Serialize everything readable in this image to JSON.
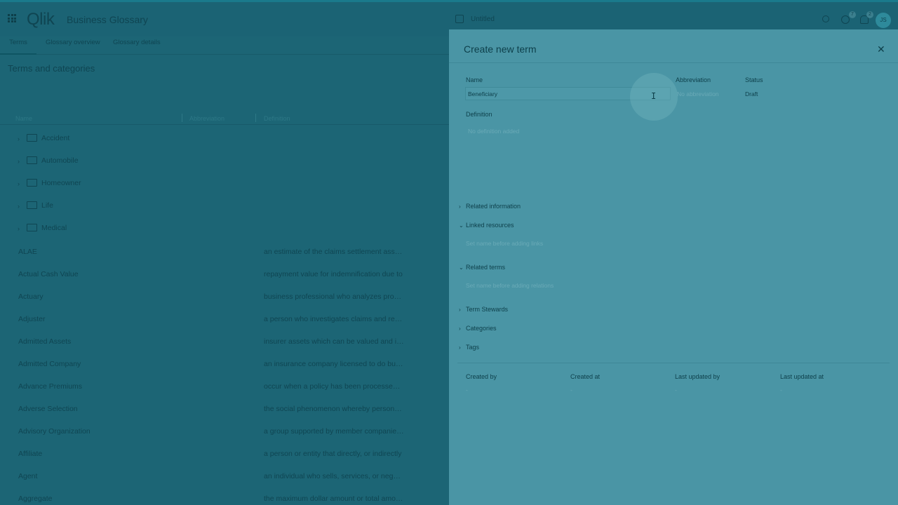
{
  "header": {
    "logo": "Qlik",
    "app_title": "Business Glossary",
    "sheet_name": "Untitled",
    "help_badge": "7",
    "notif_badge": "2",
    "avatar_initials": "JS"
  },
  "tabs": [
    {
      "label": "Terms"
    },
    {
      "label": "Glossary overview"
    },
    {
      "label": "Glossary details"
    }
  ],
  "main": {
    "section_title": "Terms and categories",
    "columns": [
      "Name",
      "Abbreviation",
      "Definition"
    ],
    "categories": [
      "Accident",
      "Automobile",
      "Homeowner",
      "Life",
      "Medical"
    ],
    "terms": [
      {
        "name": "ALAE",
        "definition": "an estimate of the claims settlement associated"
      },
      {
        "name": "Actual Cash Value",
        "definition": "repayment value for indemnification due to"
      },
      {
        "name": "Actuary",
        "definition": "business professional who analyzes probability"
      },
      {
        "name": "Adjuster",
        "definition": "a person who investigates claims and recommends"
      },
      {
        "name": "Admitted Assets",
        "definition": "insurer assets which can be valued and included"
      },
      {
        "name": "Admitted Company",
        "definition": "an insurance company licensed to do business"
      },
      {
        "name": "Advance Premiums",
        "definition": "occur when a policy has been processed, and"
      },
      {
        "name": "Adverse Selection",
        "definition": "the social phenomenon whereby persons who"
      },
      {
        "name": "Advisory Organization",
        "definition": "a group supported by member companies that"
      },
      {
        "name": "Affiliate",
        "definition": "a person or entity that directly, or indirectly"
      },
      {
        "name": "Agent",
        "definition": "an individual who sells, services, or negotiates"
      },
      {
        "name": "Aggregate",
        "definition": "the maximum dollar amount or total amount"
      }
    ]
  },
  "panel": {
    "title": "Create new term",
    "name_label": "Name",
    "name_value": "Beneficiary",
    "abbreviation_label": "Abbreviation",
    "abbreviation_placeholder": "No abbreviation",
    "status_label": "Status",
    "status_value": "Draft",
    "definition_label": "Definition",
    "definition_placeholder": "No definition added",
    "related_information": "Related information",
    "linked_resources": "Linked resources",
    "linked_resources_hint": "Set name before adding links",
    "related_terms": "Related terms",
    "related_terms_hint": "Set name before adding relations",
    "term_stewards": "Term Stewards",
    "categories": "Categories",
    "tags": "Tags",
    "created_by_label": "Created by",
    "created_at_label": "Created at",
    "last_updated_by_label": "Last updated by",
    "last_updated_at_label": "Last updated at",
    "created_by": "-",
    "created_at": "-",
    "last_updated_by": "-",
    "last_updated_at": "-"
  },
  "colors": {
    "overlay": "#1c6575",
    "panel": "#4a95a5",
    "text": "#0d3f4a"
  }
}
